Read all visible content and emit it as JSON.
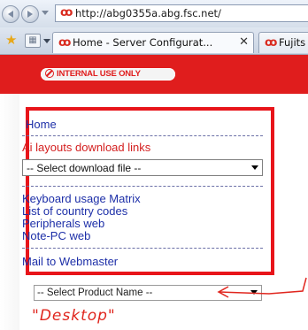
{
  "browser": {
    "url": "http://abg0355a.abg.fsc.net/",
    "tabs": [
      {
        "label": "Home - Server Configurat...",
        "active": true,
        "close": "✕"
      },
      {
        "label": "Fujits",
        "active": false
      }
    ],
    "icons": {
      "back": "back-icon",
      "forward": "forward-icon",
      "favorites": "star-icon",
      "tab_grid": "grid-icon"
    }
  },
  "header": {
    "background_color": "#e01d1d",
    "badge": "INTERNAL USE ONLY"
  },
  "nav": {
    "home": "Home",
    "ai_layouts": "Ai layouts download links",
    "download_select": {
      "selected": "-- Select download file --"
    },
    "links": [
      "Keyboard usage Matrix",
      "List of country codes",
      "Peripherals web",
      "Note-PC web"
    ],
    "mail": "Mail to Webmaster",
    "dash_line": "- - - - - - - - - - - - - - - - - - - - - - - - - - - - - - - - - -"
  },
  "product_select": {
    "selected": "-- Select Product Name --"
  },
  "annotation": {
    "text": "\"Desktop\"",
    "color": "#e0261e"
  }
}
